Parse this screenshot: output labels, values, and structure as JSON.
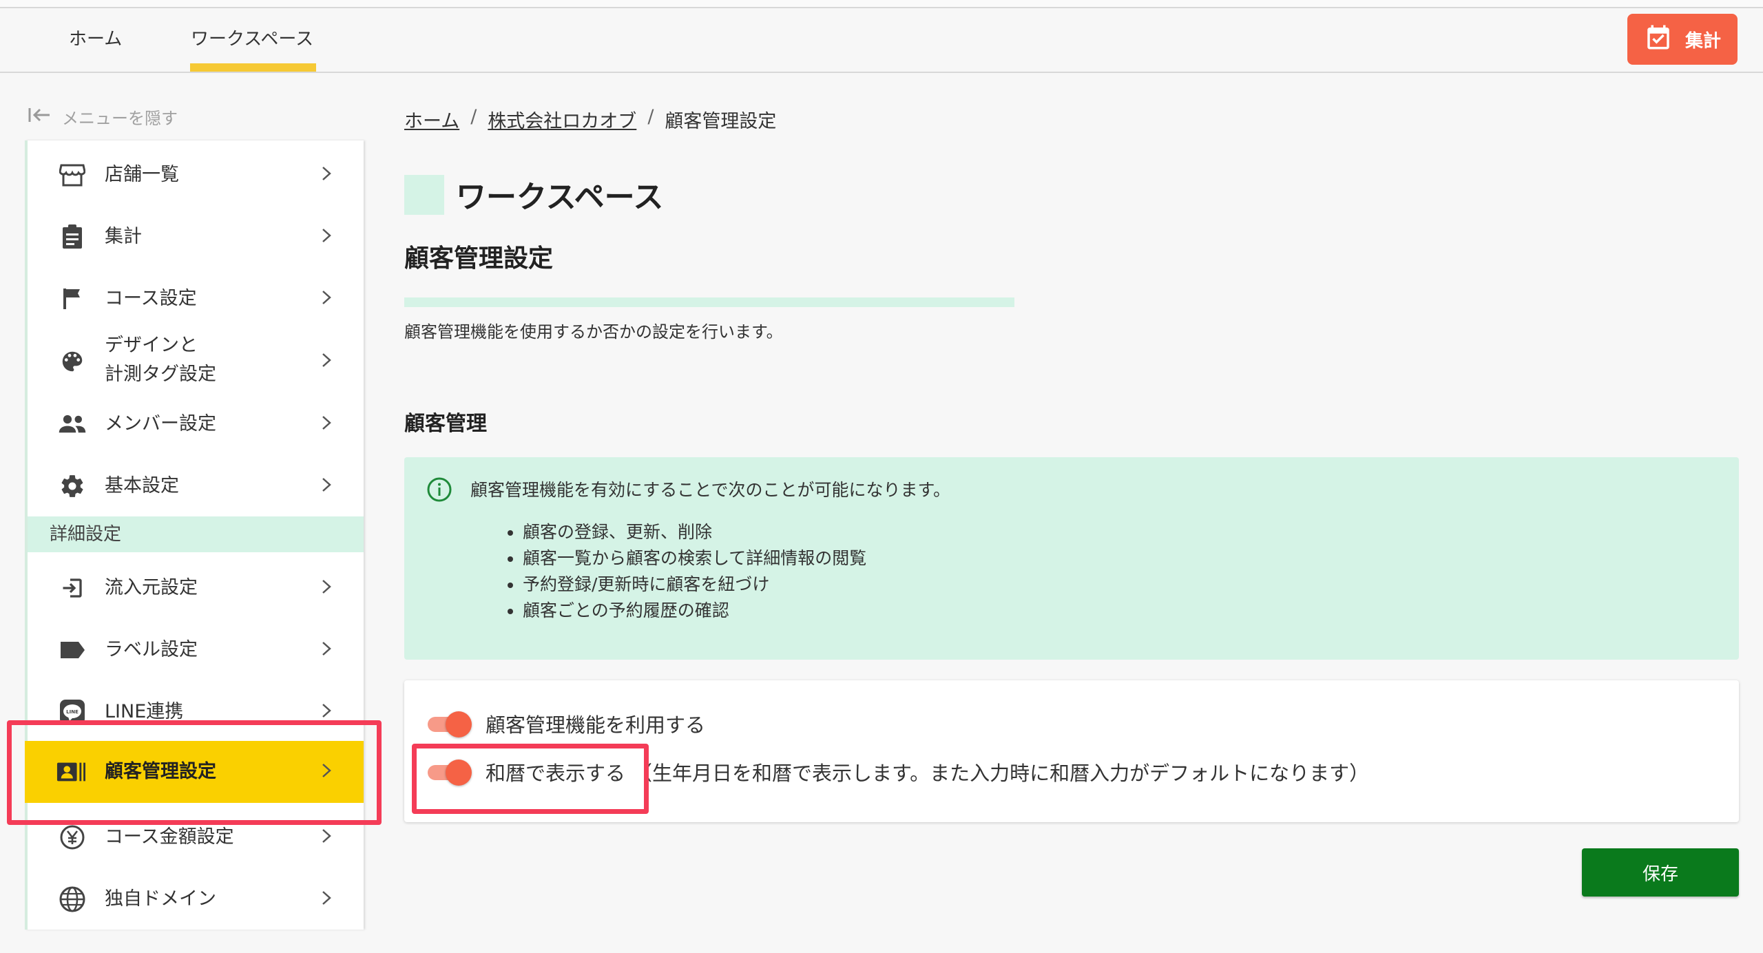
{
  "header": {
    "tabs": [
      {
        "label": "ホーム",
        "active": false
      },
      {
        "label": "ワークスペース",
        "active": true
      }
    ],
    "tally_button": {
      "label": "集計",
      "icon": "calendar-check-icon",
      "color": "#f56245"
    },
    "accent_color": "#f6c935"
  },
  "sidebar": {
    "hide_menu_label": "メニューを隠す",
    "items": [
      {
        "label": "店舗一覧",
        "icon": "store-icon"
      },
      {
        "label": "集計",
        "icon": "clipboard-icon"
      },
      {
        "label": "コース設定",
        "icon": "flag-icon"
      },
      {
        "label_line1": "デザインと",
        "label_line2": "計測タグ設定",
        "icon": "palette-icon"
      },
      {
        "label": "メンバー設定",
        "icon": "people-icon"
      },
      {
        "label": "基本設定",
        "icon": "gear-icon"
      }
    ],
    "section_label": "詳細設定",
    "detail_items": [
      {
        "label": "流入元設定",
        "icon": "login-icon"
      },
      {
        "label": "ラベル設定",
        "icon": "label-icon"
      },
      {
        "label": "LINE連携",
        "icon": "line-icon"
      },
      {
        "label": "顧客管理設定",
        "icon": "contact-card-icon",
        "active": true
      },
      {
        "label": "コース金額設定",
        "icon": "yen-icon"
      },
      {
        "label": "独自ドメイン",
        "icon": "globe-icon"
      }
    ],
    "active_color": "#fad000",
    "highlight_color": "#f43c57"
  },
  "breadcrumb": {
    "items": [
      "ホーム",
      "株式会社ロカオブ"
    ],
    "current": "顧客管理設定",
    "separator": "/"
  },
  "main": {
    "workspace_title": "ワークスペース",
    "page_title": "顧客管理設定",
    "description": "顧客管理機能を使用するか否かの設定を行います。",
    "section_title": "顧客管理",
    "info": {
      "icon": "info-icon",
      "text": "顧客管理機能を有効にすることで次のことが可能になります。",
      "bullets": [
        "顧客の登録、更新、削除",
        "顧客一覧から顧客の検索して詳細情報の閲覧",
        "予約登録/更新時に顧客を紐づけ",
        "顧客ごとの予約履歴の確認"
      ]
    },
    "toggles": [
      {
        "label": "顧客管理機能を利用する",
        "on": true
      },
      {
        "label": "和暦で表示する",
        "note": "（生年月日を和暦で表示します。また入力時に和暦入力がデフォルトになります）",
        "on": true
      }
    ],
    "save_label": "保存"
  }
}
